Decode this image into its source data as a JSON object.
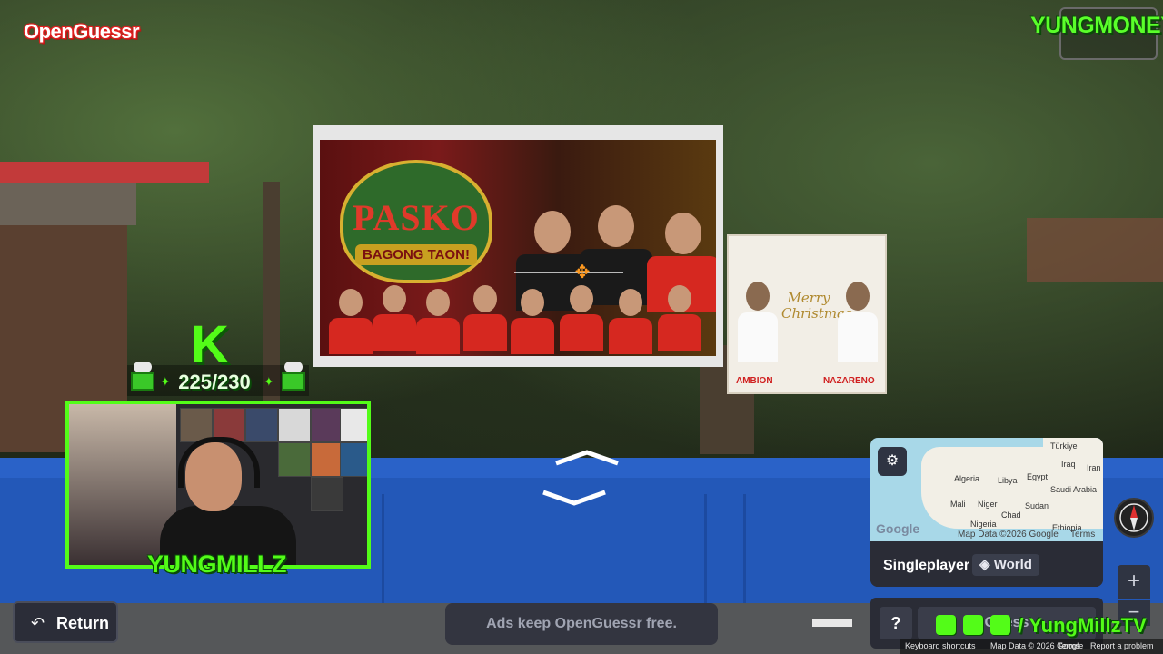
{
  "app": {
    "logo_text": "OpenGuessr"
  },
  "streamer": {
    "top_right_name": "YUNGMONEY",
    "platform_logo": "K",
    "sub_counter": "225/230",
    "cam_name": "YUNGMILLZ",
    "social_handle": "/ YungMillzTV",
    "social_icons": [
      "twitch-icon",
      "twitter-icon",
      "tiktok-icon"
    ]
  },
  "scene": {
    "billboard_title": "PASKO",
    "billboard_subtitle": "BAGONG TAON!",
    "billboard2_script": "Merry Christmas",
    "billboard2_name_left": "AMBION",
    "billboard2_name_right": "NAZARENO"
  },
  "map": {
    "labels": [
      "Türkiye",
      "Iraq",
      "Iran",
      "Algeria",
      "Libya",
      "Egypt",
      "Saudi Arabia",
      "Mali",
      "Niger",
      "Sudan",
      "Chad",
      "Nigeria",
      "Ethiopia"
    ],
    "google_logo": "Google",
    "credits": "Map Data ©2026 Google",
    "terms": "Terms",
    "settings_icon": "sliders-icon"
  },
  "mode": {
    "label": "Singleplayer",
    "region": "World",
    "region_icon": "layers-icon"
  },
  "controls": {
    "return_label": "Return",
    "return_icon": "return-arrow-icon",
    "help_label": "?",
    "guess_label": "Guess",
    "zoom_in": "+",
    "zoom_out": "−"
  },
  "ad": {
    "text": "Ads keep OpenGuessr free."
  },
  "footer": {
    "keyboard": "Keyboard shortcuts",
    "map_data": "Map Data © 2026 Google",
    "terms": "Terms",
    "report": "Report a problem"
  },
  "colors": {
    "kick_green": "#53fc18",
    "brand_red": "#e02020",
    "panel_bg": "#2a2c36"
  }
}
